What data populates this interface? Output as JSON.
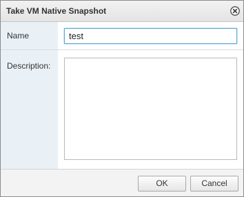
{
  "dialog": {
    "title": "Take VM Native Snapshot",
    "close_icon": "close-circle-icon"
  },
  "form": {
    "name_label": "Name",
    "name_value": "test",
    "description_label": "Description:",
    "description_value": ""
  },
  "footer": {
    "ok_label": "OK",
    "cancel_label": "Cancel"
  },
  "colors": {
    "label_column_bg": "#e9f1f7",
    "focus_border": "#5ba7d6"
  }
}
